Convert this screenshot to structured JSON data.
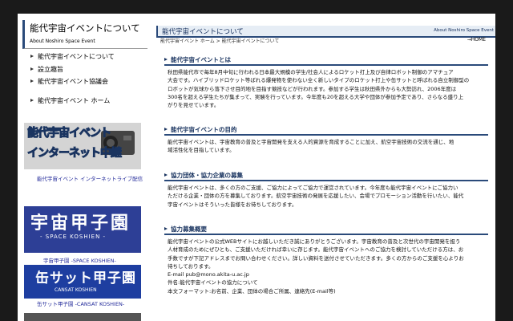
{
  "sidebar": {
    "title": "能代宇宙イベントについて",
    "subtitle": "About Noshiro Space Event",
    "nav": [
      {
        "label": "能代宇宙イベントについて"
      },
      {
        "label": "設立趣旨"
      },
      {
        "label": "能代宇宙イベント協議会"
      },
      {
        "label": "能代宇宙イベント ホーム"
      }
    ],
    "banners": [
      {
        "line1": "能代宇宙イベント",
        "line2": "インターネット中継",
        "caption": "能代宇宙イベント インターネットライブ配信"
      },
      {
        "line1": "宇宙甲子園",
        "line2": "- SPACE KOSHIEN -",
        "caption": "宇宙甲子園 -SPACE KOSHIEN-"
      },
      {
        "line1": "缶サット甲子園",
        "line2": "CANSAT KOSHIEN",
        "caption": "缶サット甲子園 -CANSAT KOSHIEN-"
      }
    ]
  },
  "main": {
    "title": "能代宇宙イベントについて",
    "title_right": "About Noshiro Space Event",
    "breadcrumb": {
      "home": "能代宇宙イベント ホーム",
      "sep": " > ",
      "current": "能代宇宙イベントについて"
    },
    "home_link": "→HOME",
    "sections": [
      {
        "heading": "能代宇宙イベントとは",
        "lines": [
          "秋田県能代市で毎年8月中旬に行われる日本最大規模の学生/社会人によるロケット打上及び自律ロボット制御のアマチュア",
          "大会です。ハイブリッドロケット等ばれる爆発物を使わない全く新しいタイプのロケット打上や缶サットと呼ばれる自立制御型の",
          "ロボットが気球から落下させ目的地を目指す競技などが行われます。参加する学生は秋田県外からも大勢訪れ、2006年度は",
          "300名を超える学生たちが集まって、実験を行っています。今年度も20を超える大学や団体が参加予定であり、さらなる盛り上",
          "がりを見せています。"
        ]
      },
      {
        "heading": "能代宇宙イベントの目的",
        "lines": [
          "能代宇宙イベントは、宇宙教育の普及と宇宙開発を支える人的資源を育成することに加え、航空宇宙技術の交流を通じ、地",
          "域活性化を目指しています。"
        ]
      },
      {
        "heading": "協力団体・協力企業の募集",
        "lines": [
          "能代宇宙イベントは、多くの方のご支援、ご協力によってご協力で運営されています。今年度も能代宇宙イベントにご協力い",
          "ただける企業・団体の方を募集しております。航空宇宙技術の発展を応援したい、会場でプロモーション活動を行いたい、能代",
          "宇宙イベントはそういった皆様をお待ちしております。"
        ]
      },
      {
        "heading": "協力募集概要",
        "lines": [
          "能代宇宙イベントの公式WEBサイトにお越しいただき誠にありがとうございます。宇宙教育の普及と次世代の宇宙開発を担う",
          "人材育成のためにぜひとも、ご支援いただければ幸いに存じます。能代宇宙イベントへのご協力を検討していただける方は、お",
          "手数ですが下記アドレスまでお問い合わせください。詳しい資料を送付させていただきます。多くの方からのご支援を心よりお",
          "待ちしております。"
        ],
        "email_label": "E-mail ",
        "email": "pub@mono.akita-u.ac.jp",
        "subject": "件名:能代宇宙イベントの協力について",
        "format": "本文フォーマット:お名前、企業、団体の場合ご所属、連絡先(E-mail等)"
      }
    ]
  },
  "colors": {
    "accent": "#2a4a7a",
    "header_bg": "#e6edf5",
    "link": "#222a9a",
    "frame": "#1a1a1a"
  }
}
